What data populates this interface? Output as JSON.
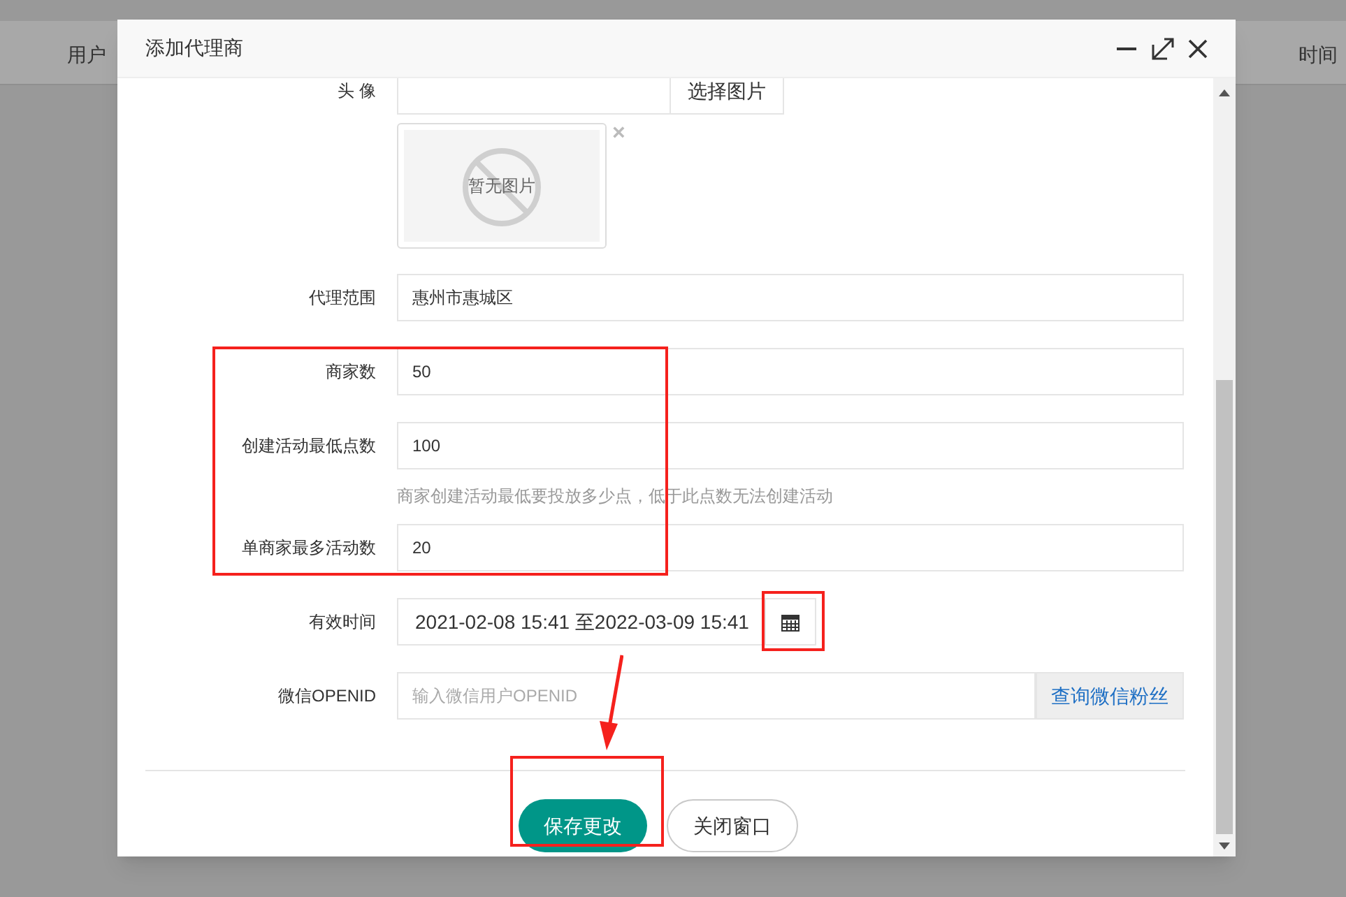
{
  "background": {
    "columns": [
      "用户",
      "时间"
    ]
  },
  "dialog": {
    "title": "添加代理商",
    "fields": [
      {
        "kind": "upload",
        "label": "头 像",
        "button": "选择图片",
        "image_text": "暂无图片",
        "remove": "×"
      },
      {
        "kind": "text",
        "label": "代理范围",
        "value": "惠州市惠城区"
      },
      {
        "kind": "text",
        "label": "商家数",
        "value": "50"
      },
      {
        "kind": "text",
        "label": "创建活动最低点数",
        "value": "100",
        "help": "商家创建活动最低要投放多少点，低于此点数无法创建活动"
      },
      {
        "kind": "text",
        "label": "单商家最多活动数",
        "value": "20"
      },
      {
        "kind": "date",
        "label": "有效时间",
        "value": "2021-02-08 15:41 至2022-03-09 15:41"
      },
      {
        "kind": "addon",
        "label": "微信OPENID",
        "placeholder": "输入微信用户OPENID",
        "button": "查询微信粉丝"
      }
    ],
    "buttons": [
      {
        "label": "保存更改",
        "primary": true
      },
      {
        "label": "关闭窗口",
        "primary": false
      }
    ]
  }
}
